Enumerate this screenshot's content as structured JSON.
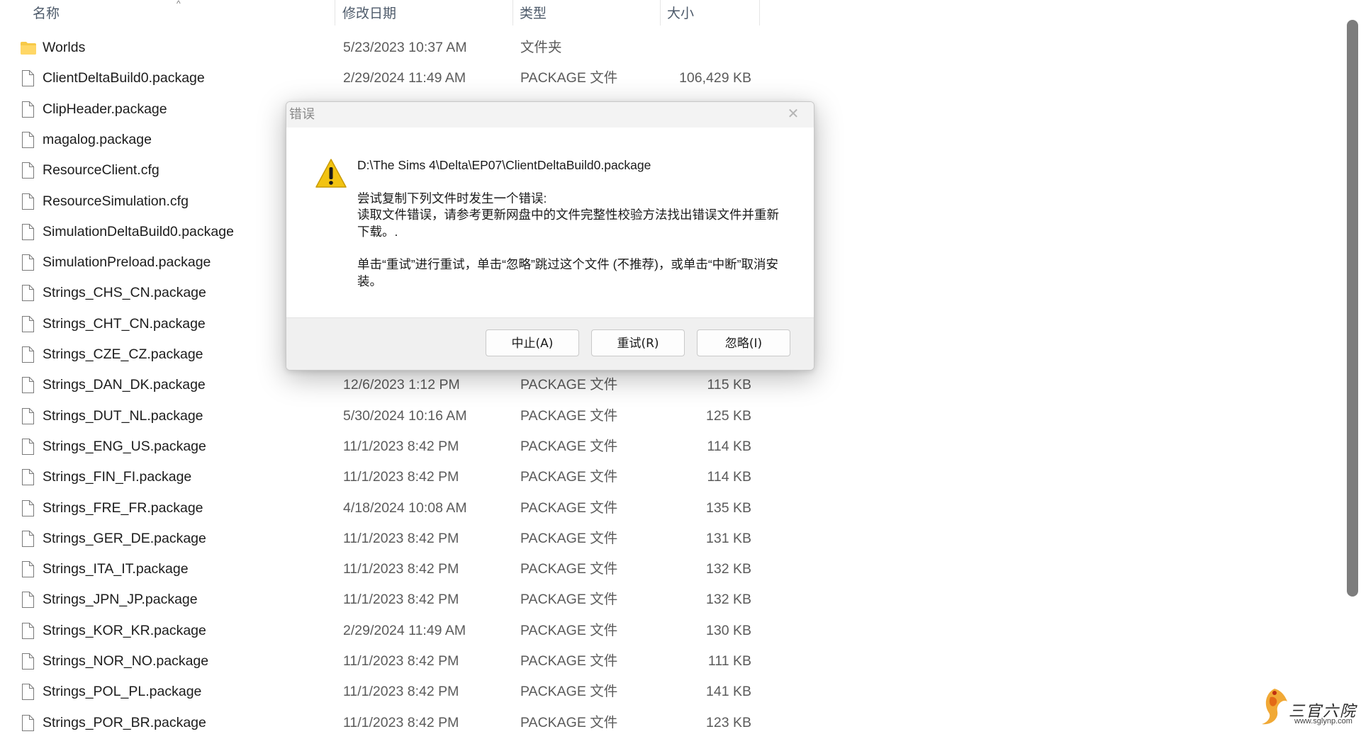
{
  "columns": {
    "name": "名称",
    "date": "修改日期",
    "type": "类型",
    "size": "大小"
  },
  "files": [
    {
      "name": "Worlds",
      "date": "5/23/2023 10:37 AM",
      "type": "文件夹",
      "size": "",
      "kind": "folder"
    },
    {
      "name": "ClientDeltaBuild0.package",
      "date": "2/29/2024 11:49 AM",
      "type": "PACKAGE 文件",
      "size": "106,429 KB",
      "kind": "file"
    },
    {
      "name": "ClipHeader.package",
      "date": "",
      "type": "",
      "size": "",
      "kind": "file"
    },
    {
      "name": "magalog.package",
      "date": "",
      "type": "",
      "size": "",
      "kind": "file"
    },
    {
      "name": "ResourceClient.cfg",
      "date": "",
      "type": "",
      "size": "",
      "kind": "file"
    },
    {
      "name": "ResourceSimulation.cfg",
      "date": "",
      "type": "",
      "size": "",
      "kind": "file"
    },
    {
      "name": "SimulationDeltaBuild0.package",
      "date": "",
      "type": "",
      "size": "",
      "kind": "file"
    },
    {
      "name": "SimulationPreload.package",
      "date": "",
      "type": "",
      "size": "",
      "kind": "file"
    },
    {
      "name": "Strings_CHS_CN.package",
      "date": "",
      "type": "",
      "size": "",
      "kind": "file"
    },
    {
      "name": "Strings_CHT_CN.package",
      "date": "",
      "type": "",
      "size": "",
      "kind": "file"
    },
    {
      "name": "Strings_CZE_CZ.package",
      "date": "",
      "type": "",
      "size": "",
      "kind": "file"
    },
    {
      "name": "Strings_DAN_DK.package",
      "date": "12/6/2023 1:12 PM",
      "type": "PACKAGE 文件",
      "size": "115 KB",
      "kind": "file"
    },
    {
      "name": "Strings_DUT_NL.package",
      "date": "5/30/2024 10:16 AM",
      "type": "PACKAGE 文件",
      "size": "125 KB",
      "kind": "file"
    },
    {
      "name": "Strings_ENG_US.package",
      "date": "11/1/2023 8:42 PM",
      "type": "PACKAGE 文件",
      "size": "114 KB",
      "kind": "file"
    },
    {
      "name": "Strings_FIN_FI.package",
      "date": "11/1/2023 8:42 PM",
      "type": "PACKAGE 文件",
      "size": "114 KB",
      "kind": "file"
    },
    {
      "name": "Strings_FRE_FR.package",
      "date": "4/18/2024 10:08 AM",
      "type": "PACKAGE 文件",
      "size": "135 KB",
      "kind": "file"
    },
    {
      "name": "Strings_GER_DE.package",
      "date": "11/1/2023 8:42 PM",
      "type": "PACKAGE 文件",
      "size": "131 KB",
      "kind": "file"
    },
    {
      "name": "Strings_ITA_IT.package",
      "date": "11/1/2023 8:42 PM",
      "type": "PACKAGE 文件",
      "size": "132 KB",
      "kind": "file"
    },
    {
      "name": "Strings_JPN_JP.package",
      "date": "11/1/2023 8:42 PM",
      "type": "PACKAGE 文件",
      "size": "132 KB",
      "kind": "file"
    },
    {
      "name": "Strings_KOR_KR.package",
      "date": "2/29/2024 11:49 AM",
      "type": "PACKAGE 文件",
      "size": "130 KB",
      "kind": "file"
    },
    {
      "name": "Strings_NOR_NO.package",
      "date": "11/1/2023 8:42 PM",
      "type": "PACKAGE 文件",
      "size": "111 KB",
      "kind": "file"
    },
    {
      "name": "Strings_POL_PL.package",
      "date": "11/1/2023 8:42 PM",
      "type": "PACKAGE 文件",
      "size": "141 KB",
      "kind": "file"
    },
    {
      "name": "Strings_POR_BR.package",
      "date": "11/1/2023 8:42 PM",
      "type": "PACKAGE 文件",
      "size": "123 KB",
      "kind": "file"
    }
  ],
  "dialog": {
    "title": "错误",
    "path": "D:\\The Sims 4\\Delta\\EP07\\ClientDeltaBuild0.package",
    "line1": "尝试复制下列文件时发生一个错误:",
    "line2": "读取文件错误，请参考更新网盘中的文件完整性校验方法找出错误文件并重新下载。.",
    "line3": "单击“重试”进行重试，单击“忽略”跳过这个文件 (不推荐)，或单击“中断”取消安装。",
    "buttons": {
      "abort": "中止(A)",
      "retry": "重试(R)",
      "ignore": "忽略(I)"
    },
    "icon": "warning-icon",
    "close_icon": "close-icon"
  },
  "watermark": {
    "text": "三官六院",
    "url": "www.sglynp.com"
  },
  "colors": {
    "warning": "#f2c311",
    "folder": "#f7c948"
  }
}
